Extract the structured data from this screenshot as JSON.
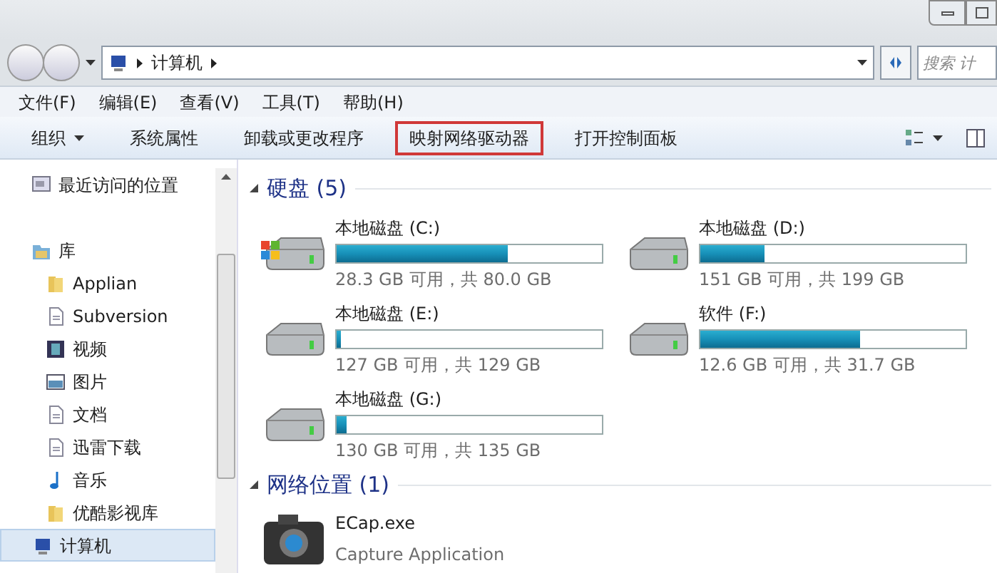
{
  "address_bar": {
    "path": [
      {
        "label": "计算机"
      }
    ],
    "search_placeholder": "搜索 计"
  },
  "menu": [
    "文件(F)",
    "编辑(E)",
    "查看(V)",
    "工具(T)",
    "帮助(H)"
  ],
  "toolbar": [
    {
      "label": "组织",
      "dropdown": true,
      "highlighted": false
    },
    {
      "label": "系统属性",
      "dropdown": false,
      "highlighted": false
    },
    {
      "label": "卸载或更改程序",
      "dropdown": false,
      "highlighted": false
    },
    {
      "label": "映射网络驱动器",
      "dropdown": false,
      "highlighted": true
    },
    {
      "label": "打开控制面板",
      "dropdown": false,
      "highlighted": false
    }
  ],
  "sidebar": {
    "items": [
      {
        "label": "最近访问的位置",
        "kind": "recent",
        "selected": false
      },
      {
        "label": "库",
        "kind": "library",
        "selected": false,
        "children": [
          {
            "label": "Applian",
            "kind": "folder",
            "selected": false
          },
          {
            "label": "Subversion",
            "kind": "doc",
            "selected": false
          },
          {
            "label": "视频",
            "kind": "video",
            "selected": false
          },
          {
            "label": "图片",
            "kind": "picture",
            "selected": false
          },
          {
            "label": "文档",
            "kind": "doc",
            "selected": false
          },
          {
            "label": "迅雷下载",
            "kind": "doc",
            "selected": false
          },
          {
            "label": "音乐",
            "kind": "music",
            "selected": false
          },
          {
            "label": "优酷影视库",
            "kind": "folder",
            "selected": false
          }
        ]
      },
      {
        "label": "计算机",
        "kind": "computer",
        "selected": true
      }
    ]
  },
  "groups": [
    {
      "title": "硬盘 (5)",
      "expanded": true,
      "items": [
        {
          "kind": "drive",
          "name": "本地磁盘 (C:)",
          "system": true,
          "level": 0.646,
          "info": "28.3 GB 可用，共 80.0 GB"
        },
        {
          "kind": "drive",
          "name": "本地磁盘 (D:)",
          "system": false,
          "level": 0.24,
          "info": "151 GB 可用，共 199 GB"
        },
        {
          "kind": "drive",
          "name": "本地磁盘 (E:)",
          "system": false,
          "level": 0.016,
          "info": "127 GB 可用，共 129 GB"
        },
        {
          "kind": "drive",
          "name": "软件 (F:)",
          "system": false,
          "level": 0.6,
          "info": "12.6 GB 可用，共 31.7 GB"
        },
        {
          "kind": "drive",
          "name": "本地磁盘 (G:)",
          "system": false,
          "level": 0.037,
          "info": "130 GB 可用，共 135 GB"
        }
      ]
    },
    {
      "title": "网络位置 (1)",
      "expanded": true,
      "items": [
        {
          "kind": "app",
          "name": "ECap.exe",
          "info": "Capture Application"
        }
      ]
    }
  ]
}
